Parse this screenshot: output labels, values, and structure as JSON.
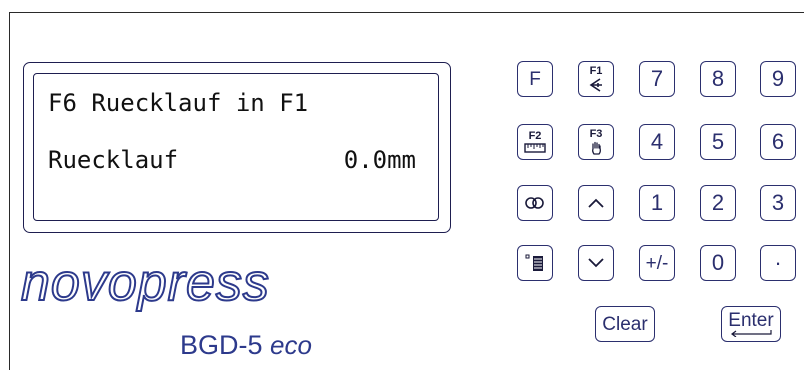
{
  "display": {
    "line1": "F6 Ruecklauf in F1",
    "line2_label": "Ruecklauf",
    "line2_value": "0.0mm"
  },
  "brand": {
    "logo_text": "novopress",
    "model": "BGD-5",
    "model_suffix": "eco"
  },
  "keypad": {
    "f": "F",
    "f1": "F1",
    "f2": "F2",
    "f3": "F3",
    "digits": {
      "d7": "7",
      "d8": "8",
      "d9": "9",
      "d4": "4",
      "d5": "5",
      "d6": "6",
      "d1": "1",
      "d2": "2",
      "d3": "3",
      "d0": "0"
    },
    "plus_minus": "+/-",
    "dot": "·",
    "clear": "Clear",
    "enter": "Enter",
    "icons": {
      "f1": "angle-icon",
      "f2": "ruler-icon",
      "f3": "hand-icon",
      "loop": "loop-icon",
      "up": "chevron-up-icon",
      "down": "chevron-down-icon",
      "list": "list-icon",
      "enter": "return-arrow-icon"
    }
  },
  "colors": {
    "key_border": "#2b2f6e",
    "brand": "#2d3a8c",
    "lcd_frame": "#1e1e50"
  }
}
